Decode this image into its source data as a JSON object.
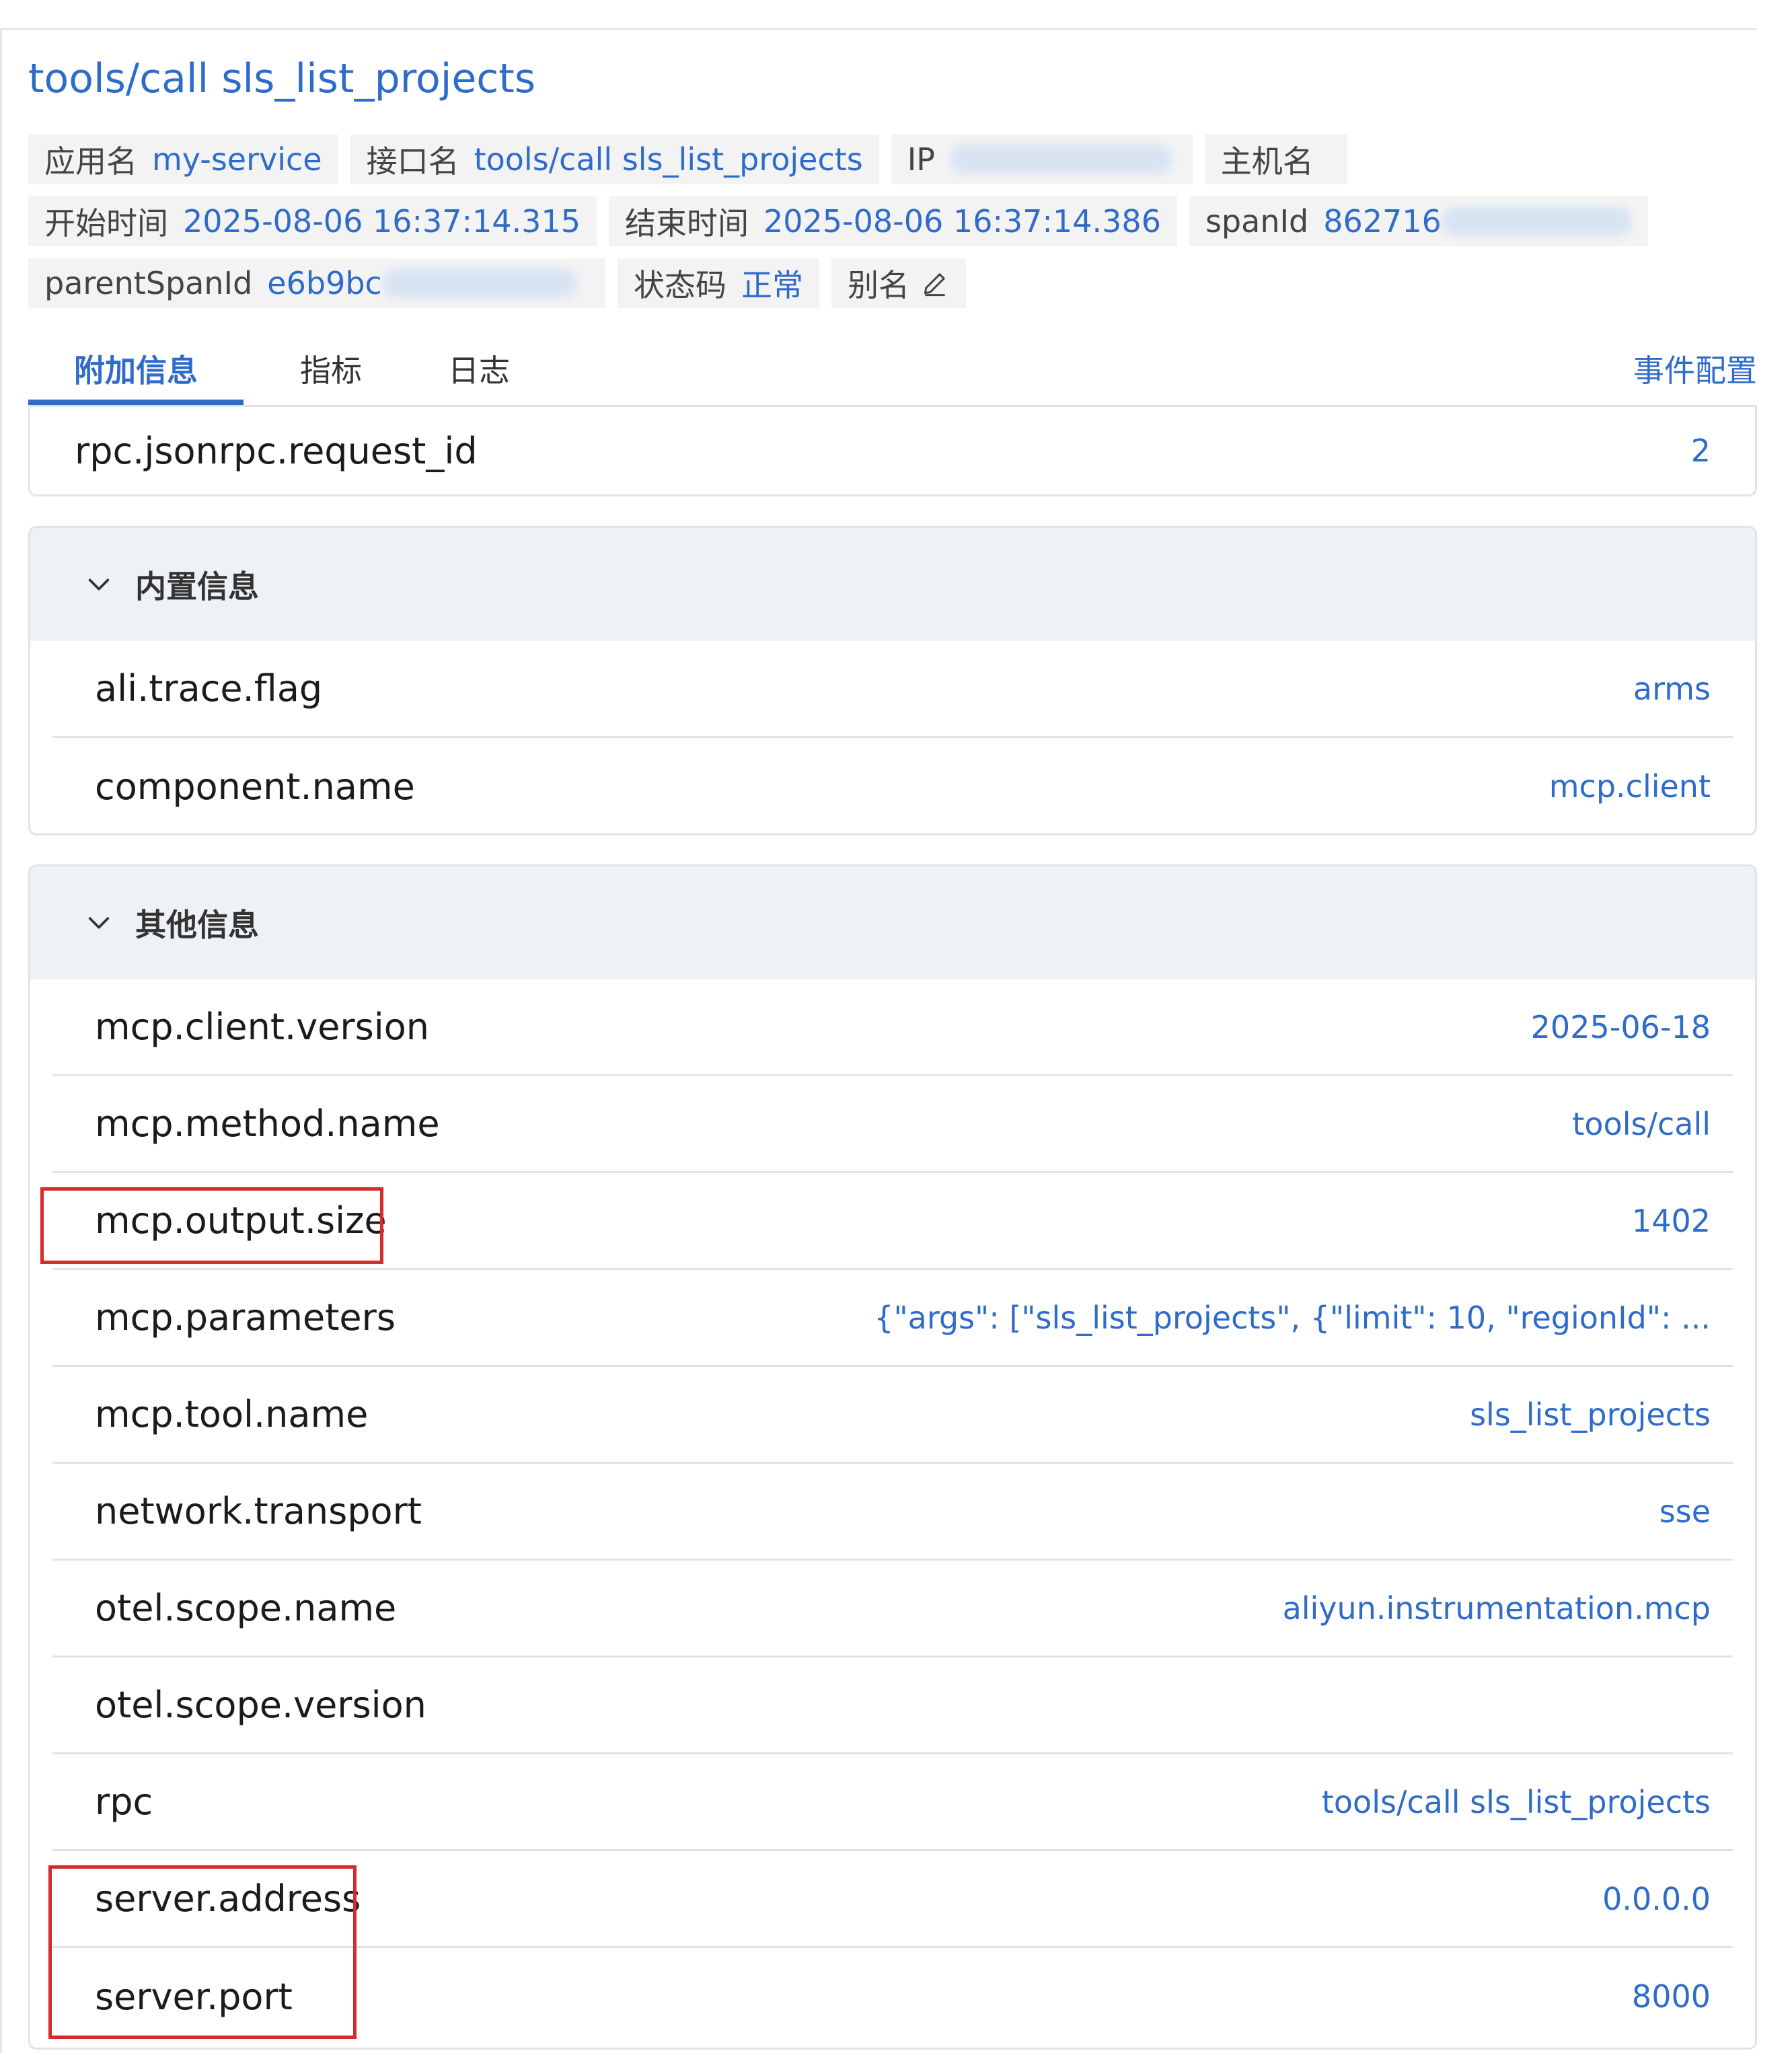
{
  "header": {
    "title": "tools/call sls_list_projects"
  },
  "info": {
    "app_label": "应用名",
    "app_value": "my-service",
    "iface_label": "接口名",
    "iface_value": "tools/call sls_list_projects",
    "ip_label": "IP",
    "host_label": "主机名",
    "start_label": "开始时间",
    "start_value": "2025-08-06 16:37:14.315",
    "end_label": "结束时间",
    "end_value": "2025-08-06 16:37:14.386",
    "spanid_label": "spanId",
    "spanid_value": "862716",
    "parent_label": "parentSpanId",
    "parent_value": "e6b9bc",
    "status_label": "状态码",
    "status_value": "正常",
    "alias_label": "别名"
  },
  "tabs": {
    "items": [
      "附加信息",
      "指标",
      "日志"
    ],
    "active_index": 0,
    "event_config": "事件配置"
  },
  "top_attr": {
    "key": "rpc.jsonrpc.request_id",
    "value": "2"
  },
  "builtin": {
    "title": "内置信息",
    "rows": [
      {
        "key": "ali.trace.flag",
        "value": "arms"
      },
      {
        "key": "component.name",
        "value": "mcp.client"
      }
    ]
  },
  "other": {
    "title": "其他信息",
    "rows": [
      {
        "key": "mcp.client.version",
        "value": "2025-06-18"
      },
      {
        "key": "mcp.method.name",
        "value": "tools/call"
      },
      {
        "key": "mcp.output.size",
        "value": "1402"
      },
      {
        "key": "mcp.parameters",
        "value": "{\"args\": [\"sls_list_projects\", {\"limit\": 10, \"regionId\": ..."
      },
      {
        "key": "mcp.tool.name",
        "value": "sls_list_projects"
      },
      {
        "key": "network.transport",
        "value": "sse"
      },
      {
        "key": "otel.scope.name",
        "value": "aliyun.instrumentation.mcp"
      },
      {
        "key": "otel.scope.version",
        "value": ""
      },
      {
        "key": "rpc",
        "value": "tools/call sls_list_projects"
      },
      {
        "key": "server.address",
        "value": "0.0.0.0"
      },
      {
        "key": "server.port",
        "value": "8000"
      }
    ]
  },
  "colors": {
    "accent": "#2f6cc9",
    "highlight": "#d52b2b"
  },
  "icons": {
    "collapse": "chevron-down-icon",
    "edit": "pencil-icon"
  }
}
